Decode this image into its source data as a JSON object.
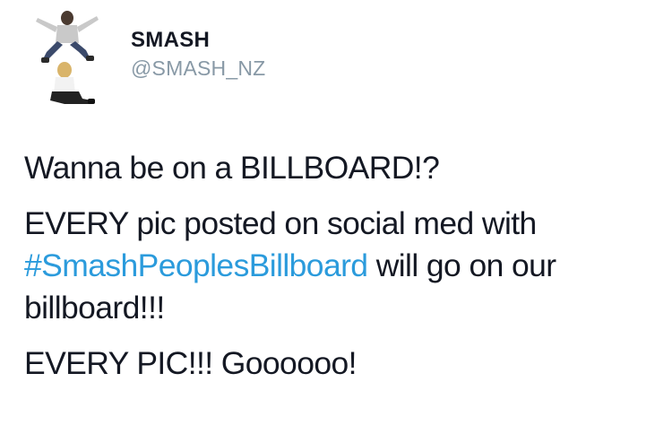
{
  "tweet": {
    "display_name": "SMASH",
    "handle": "@SMASH_NZ",
    "line1": "Wanna be on a BILLBOARD!?",
    "line2_prefix": "EVERY pic posted on social med with",
    "hashtag": "#SmashPeoplesBillboard",
    "line3_suffix": " will go on our",
    "line4": "billboard!!!",
    "line5": "EVERY PIC!!! Goooooo!"
  },
  "colors": {
    "hashtag": "#2b9bdc",
    "handle": "#8899a6",
    "text": "#141823"
  },
  "icons": {
    "avatar": "profile-photo"
  }
}
